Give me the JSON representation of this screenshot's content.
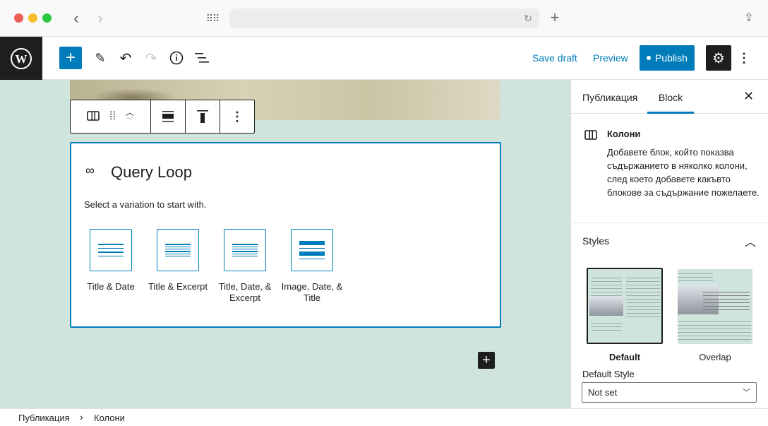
{
  "toolbar": {
    "save_draft": "Save draft",
    "preview": "Preview",
    "publish": "Publish"
  },
  "query_loop": {
    "title": "Query Loop",
    "instruction": "Select a variation to start with.",
    "variations": [
      "Title & Date",
      "Title & Excerpt",
      "Title, Date, & Excerpt",
      "Image, Date, & Title"
    ]
  },
  "sidebar": {
    "tabs": [
      "Публикация",
      "Block"
    ],
    "active_tab": "Block",
    "block_name": "Колони",
    "block_description": "Добавете блок, който показва съдържанието в няколко колони, след което добавете какъвто блокове за съдържание пожелаете.",
    "styles_heading": "Styles",
    "styles": [
      "Default",
      "Overlap"
    ],
    "selected_style": "Default",
    "default_style_label": "Default Style",
    "default_style_value": "Not set"
  },
  "breadcrumb": [
    "Публикация",
    "Колони"
  ],
  "colors": {
    "accent": "#007cba",
    "canvas": "#cfe4dc",
    "dark": "#1e1e1e"
  }
}
